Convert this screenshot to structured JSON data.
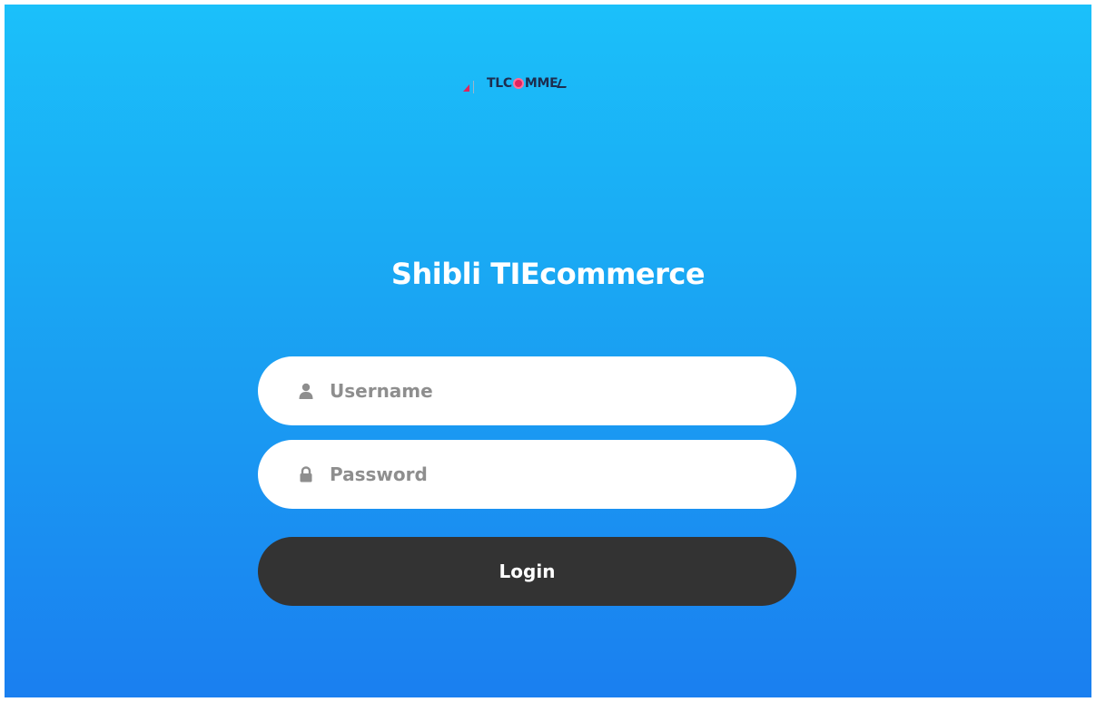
{
  "brand": {
    "logo_text_prefix": "TLC",
    "logo_text_suffix": "MME",
    "logo_icon": "tlcommerce-logo-icon"
  },
  "app_title": "Shibli TIEcommerce",
  "form": {
    "username": {
      "placeholder": "Username",
      "value": "",
      "icon": "user-icon"
    },
    "password": {
      "placeholder": "Password",
      "value": "",
      "icon": "lock-icon"
    },
    "login_label": "Login"
  },
  "colors": {
    "background_top": "#1bc0fa",
    "background_bottom": "#1a7ff0",
    "button": "#333333",
    "placeholder": "#8e8e8e",
    "logo_accent": "#e0245e",
    "logo_text": "#1d2d4f"
  }
}
